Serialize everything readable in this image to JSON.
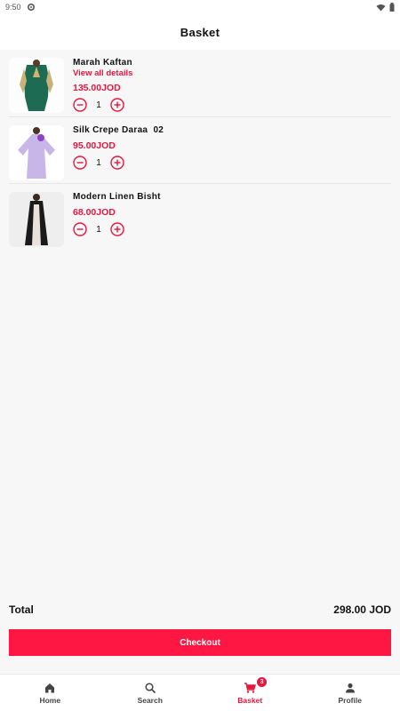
{
  "status_bar": {
    "time": "9:50"
  },
  "header": {
    "title": "Basket"
  },
  "items": [
    {
      "name": "Marah Kaftan",
      "details_link": "View all details",
      "price": "135.00JOD",
      "quantity": "1"
    },
    {
      "name": "Silk Crepe Daraa  02",
      "price": "95.00JOD",
      "quantity": "1"
    },
    {
      "name": "Modern Linen Bisht",
      "price": "68.00JOD",
      "quantity": "1"
    }
  ],
  "summary": {
    "total_label": "Total",
    "total_value": "298.00 JOD"
  },
  "checkout_label": "Checkout",
  "nav": {
    "home": "Home",
    "search": "Search",
    "basket": "Basket",
    "basket_badge": "3",
    "profile": "Profile"
  },
  "colors": {
    "accent": "#e5173f",
    "checkout_bg": "#ff1744"
  },
  "icons": [
    "settings-icon",
    "wifi-icon",
    "battery-icon",
    "minus-circle-icon",
    "plus-circle-icon",
    "home-icon",
    "search-icon",
    "cart-icon",
    "person-icon"
  ]
}
